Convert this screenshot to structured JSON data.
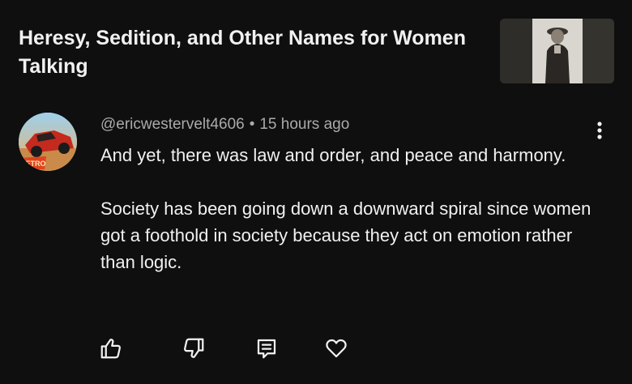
{
  "video": {
    "title": "Heresy, Sedition, and Other Names for Women Talking"
  },
  "comment": {
    "author": "@ericwestervelt4606",
    "separator": "•",
    "time": "15 hours ago",
    "paragraphs": [
      "And yet, there was law and order, and peace and harmony.",
      "Society has been going down a downward spiral since women got a foothold in society because they act on emotion rather than logic."
    ],
    "avatar_text": "RETRO"
  },
  "actions": {
    "like_icon": "thumbs-up-icon",
    "dislike_icon": "thumbs-down-icon",
    "reply_icon": "comment-reply-icon",
    "heart_icon": "heart-icon"
  },
  "colors": {
    "background": "#0f0f0f",
    "text": "#f1f1f1",
    "secondary_text": "#aaaaaa"
  }
}
